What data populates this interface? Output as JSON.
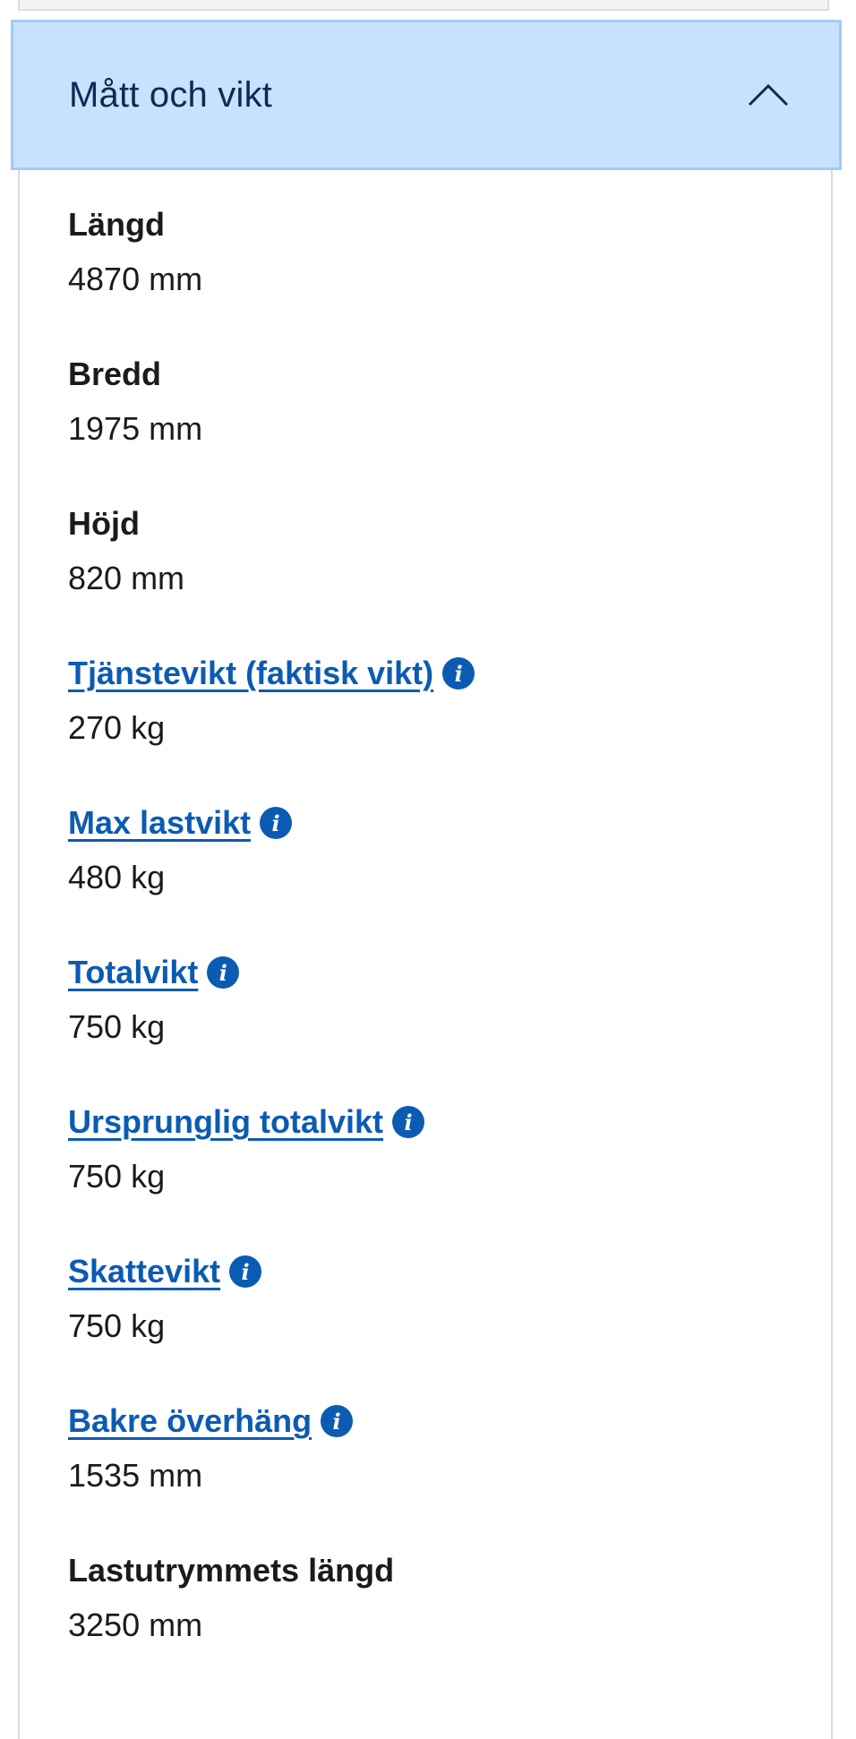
{
  "accordion": {
    "title": "Mått och vikt",
    "expanded": true,
    "toggle_icon": "chevron-up-icon"
  },
  "colors": {
    "header_bg": "#c7e2fd",
    "header_border": "#a3cbf5",
    "title": "#0a2b55",
    "link": "#0b5bb3",
    "text": "#1b1b1b"
  },
  "items": [
    {
      "label": "Längd",
      "value": "4870 mm",
      "link": false
    },
    {
      "label": "Bredd",
      "value": "1975 mm",
      "link": false
    },
    {
      "label": "Höjd",
      "value": "820 mm",
      "link": false
    },
    {
      "label": "Tjänstevikt (faktisk vikt)",
      "value": "270 kg",
      "link": true,
      "icon": "info-icon",
      "icon_glyph": "i"
    },
    {
      "label": "Max lastvikt",
      "value": "480 kg",
      "link": true,
      "icon": "info-icon",
      "icon_glyph": "i"
    },
    {
      "label": "Totalvikt",
      "value": "750 kg",
      "link": true,
      "icon": "info-icon",
      "icon_glyph": "i"
    },
    {
      "label": "Ursprunglig totalvikt",
      "value": "750 kg",
      "link": true,
      "icon": "info-icon",
      "icon_glyph": "i"
    },
    {
      "label": "Skattevikt",
      "value": "750 kg",
      "link": true,
      "icon": "info-icon",
      "icon_glyph": "i"
    },
    {
      "label": "Bakre överhäng",
      "value": "1535 mm",
      "link": true,
      "icon": "info-icon",
      "icon_glyph": "i"
    },
    {
      "label": "Lastutrymmets längd",
      "value": "3250 mm",
      "link": false
    }
  ]
}
